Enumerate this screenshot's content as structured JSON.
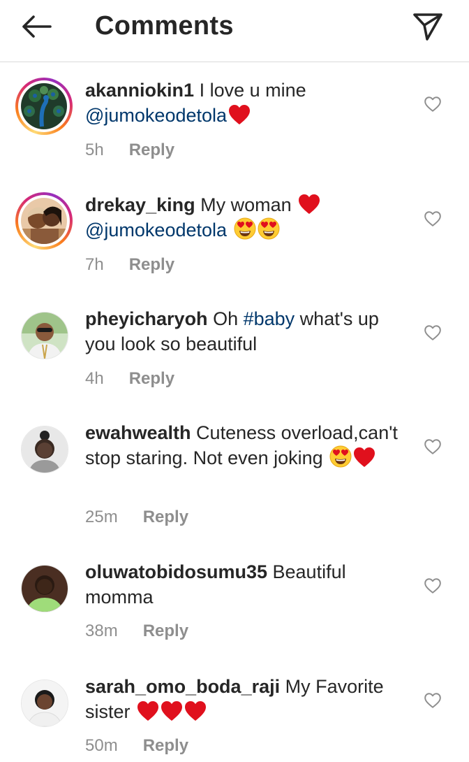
{
  "header": {
    "title": "Comments",
    "back_icon": "arrow-left-icon",
    "send_icon": "paper-plane-icon"
  },
  "colors": {
    "mention": "#00376b",
    "meta": "#8e8e8e",
    "heart": "#e0101d"
  },
  "comments": [
    {
      "username": "akanniokin1",
      "text_before": " I love u mine ",
      "mention": "@jumokeodetola",
      "emojis": [
        "red-heart"
      ],
      "time": "5h",
      "reply": "Reply",
      "story_ring": true
    },
    {
      "username": "drekay_king",
      "text_before": " My woman ",
      "mention": "@jumokeodetola",
      "emojis_before_mention": [
        "red-heart"
      ],
      "emojis": [
        "heart-eyes",
        "heart-eyes"
      ],
      "time": "7h",
      "reply": "Reply",
      "story_ring": true
    },
    {
      "username": "pheyicharyoh",
      "text_before": " Oh ",
      "hashtag": "#baby",
      "text_after": " what's up you look so beautiful",
      "time": "4h",
      "reply": "Reply",
      "story_ring": false
    },
    {
      "username": "ewahwealth",
      "text_before": " Cuteness overload,can't stop staring. Not even joking ",
      "emojis": [
        "heart-eyes",
        "red-heart"
      ],
      "time": "25m",
      "reply": "Reply",
      "story_ring": false
    },
    {
      "username": "oluwatobidosumu35",
      "text_before": " Beautiful momma",
      "time": "38m",
      "reply": "Reply",
      "story_ring": false
    },
    {
      "username": "sarah_omo_boda_raji",
      "text_before": " My Favorite sister ",
      "emojis": [
        "red-heart",
        "red-heart",
        "red-heart"
      ],
      "time": "50m",
      "reply": "Reply",
      "story_ring": false
    }
  ]
}
